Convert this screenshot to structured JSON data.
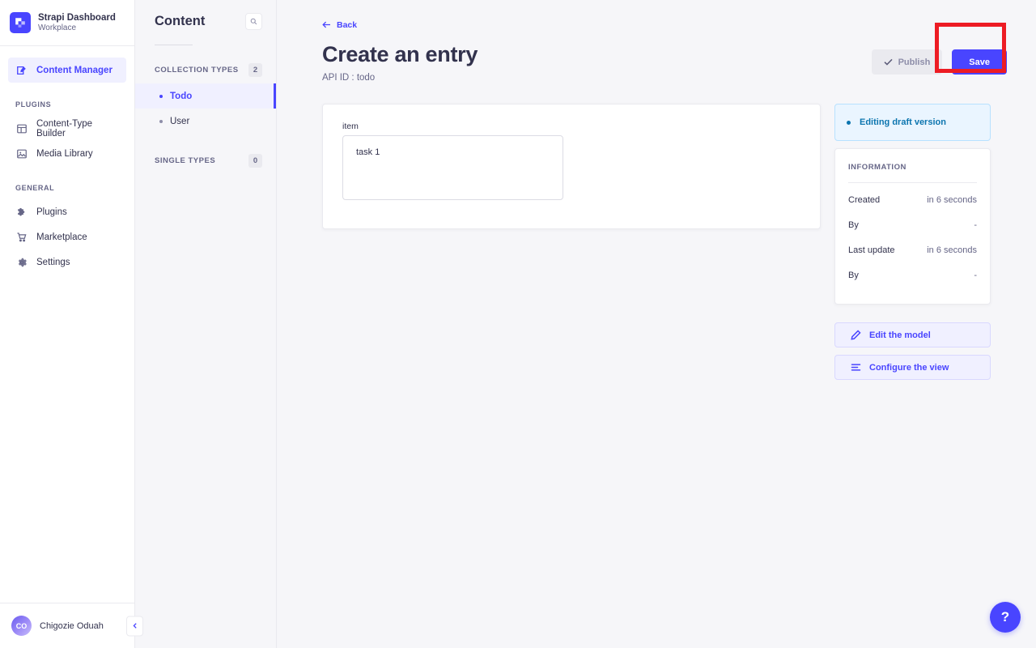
{
  "brand": {
    "title": "Strapi Dashboard",
    "subtitle": "Workplace",
    "logo_icon": "strapi-logo-icon",
    "accent_color": "#4945ff"
  },
  "sidebar": {
    "primary": [
      {
        "label": "Content Manager",
        "icon": "content-manager-icon",
        "active": true
      }
    ],
    "sections": [
      {
        "label": "PLUGINS",
        "items": [
          {
            "label": "Content-Type Builder",
            "icon": "layout-icon"
          },
          {
            "label": "Media Library",
            "icon": "image-icon"
          }
        ]
      },
      {
        "label": "GENERAL",
        "items": [
          {
            "label": "Plugins",
            "icon": "puzzle-icon"
          },
          {
            "label": "Marketplace",
            "icon": "shopping-cart-icon"
          },
          {
            "label": "Settings",
            "icon": "gear-icon"
          }
        ]
      }
    ],
    "user": {
      "name": "Chigozie Oduah",
      "initials": "CO",
      "collapse_icon": "chevron-left-icon"
    }
  },
  "content_panel": {
    "title": "Content",
    "search_icon": "search-icon",
    "groups": [
      {
        "label": "COLLECTION TYPES",
        "count": "2",
        "items": [
          {
            "label": "Todo",
            "selected": true
          },
          {
            "label": "User",
            "selected": false
          }
        ]
      },
      {
        "label": "SINGLE TYPES",
        "count": "0",
        "items": []
      }
    ]
  },
  "main": {
    "back_label": "Back",
    "back_icon": "arrow-left-icon",
    "title": "Create an entry",
    "subtitle": "API ID : todo",
    "actions": {
      "publish_label": "Publish",
      "publish_icon": "check-icon",
      "publish_disabled": true,
      "save_label": "Save"
    },
    "form": {
      "field_label": "item",
      "field_value": "task 1",
      "field_placeholder": ""
    }
  },
  "side_panel": {
    "draft_status": "Editing draft version",
    "information": {
      "heading": "INFORMATION",
      "rows": [
        {
          "key": "Created",
          "value": "in 6 seconds"
        },
        {
          "key": "By",
          "value": "-"
        },
        {
          "key": "Last update",
          "value": "in 6 seconds"
        },
        {
          "key": "By",
          "value": "-"
        }
      ]
    },
    "buttons": [
      {
        "label": "Edit the model",
        "icon": "pencil-icon"
      },
      {
        "label": "Configure the view",
        "icon": "sliders-icon"
      }
    ]
  },
  "help": {
    "label": "?"
  },
  "annotation": {
    "target": "save-button",
    "color": "#ed1c24"
  }
}
